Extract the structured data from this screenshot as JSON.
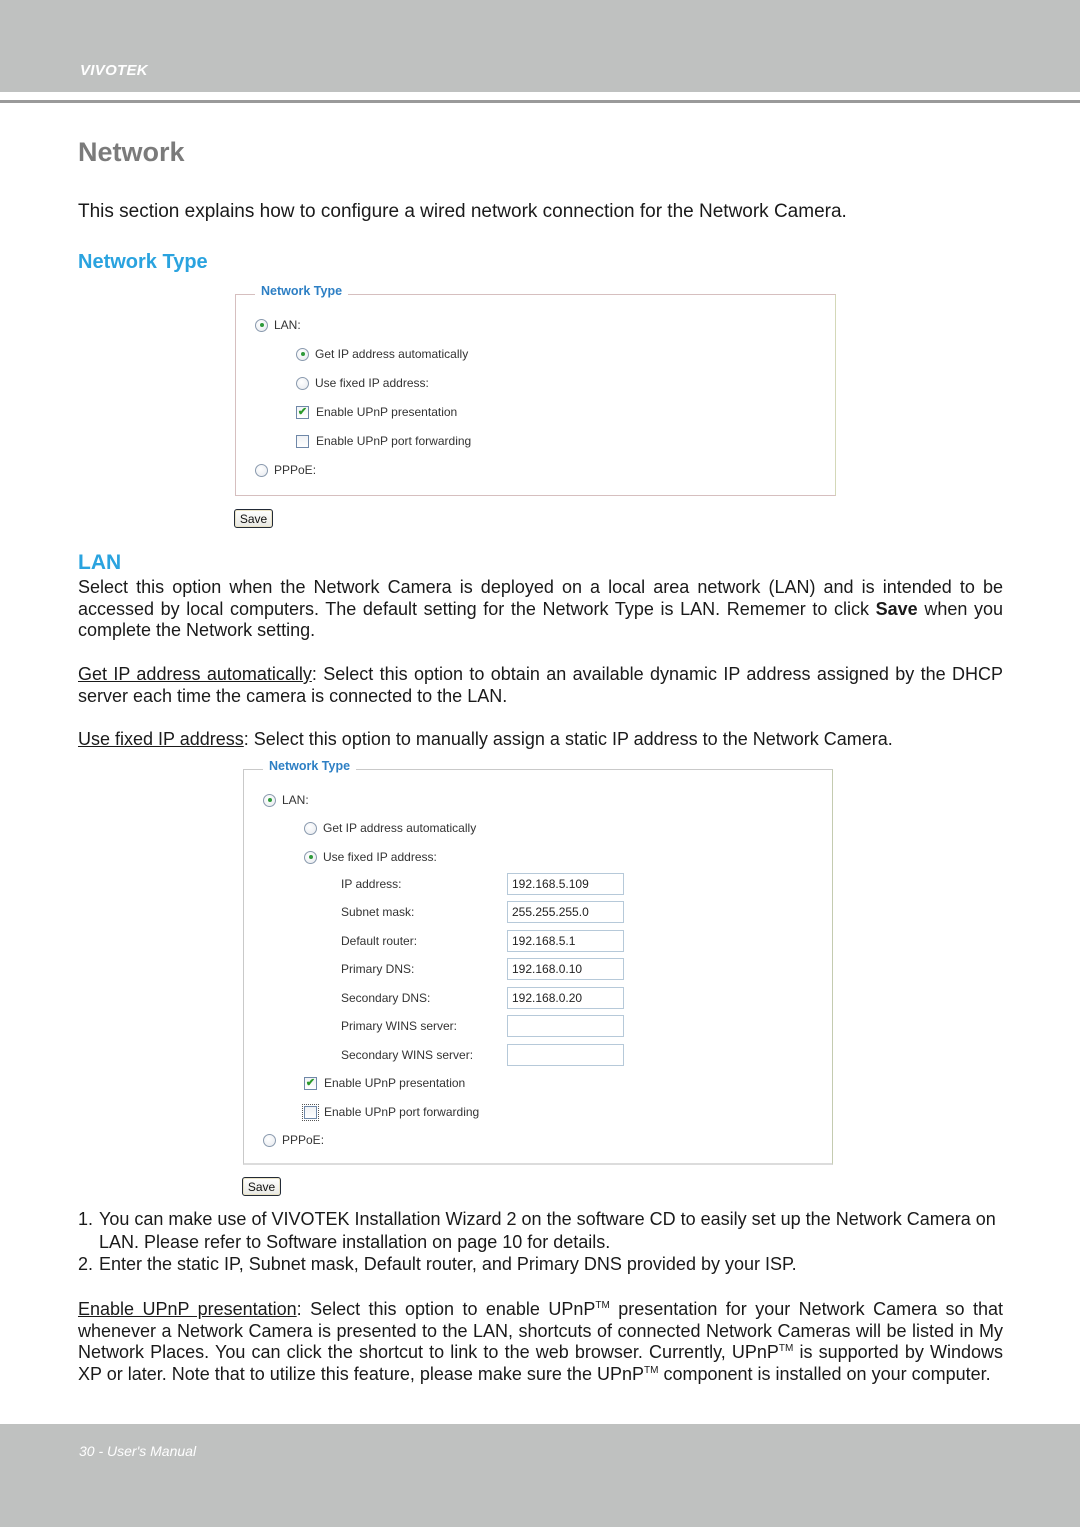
{
  "header": {
    "brand": "VIVOTEK"
  },
  "page": {
    "title": "Network",
    "intro": "This section explains how to configure a wired network connection for the Network Camera.",
    "section_heading": "Network Type"
  },
  "panel1": {
    "legend": "Network Type",
    "lan_label": "LAN:",
    "lan_selected": true,
    "get_ip_auto_label": "Get IP address automatically",
    "get_ip_auto_selected": true,
    "use_fixed_label": "Use fixed IP address:",
    "use_fixed_selected": false,
    "upnp_presentation_label": "Enable UPnP presentation",
    "upnp_presentation_checked": true,
    "upnp_port_forwarding_label": "Enable UPnP port forwarding",
    "upnp_port_forwarding_checked": false,
    "pppoe_label": "PPPoE:",
    "pppoe_selected": false,
    "save_label": "Save",
    "check_glyph": "✔"
  },
  "lan": {
    "heading": "LAN",
    "para1_pre": "Select this option when the Network Camera is deployed on a local area network (LAN) and is intended to be accessed by local computers. The default setting for the Network Type is LAN. Rememer to click ",
    "para1_bold": "Save",
    "para1_post": " when you complete the Network setting.",
    "auto_term": "Get IP address automatically",
    "auto_desc": ": Select this option to obtain an available dynamic IP address assigned by the DHCP server each time the camera is connected to the LAN.",
    "fixed_term": "Use fixed IP address",
    "fixed_desc": ": Select this option to manually assign a static IP address to the Network Camera."
  },
  "panel2": {
    "legend": "Network Type",
    "lan_label": "LAN:",
    "lan_selected": true,
    "get_ip_auto_label": "Get IP address automatically",
    "get_ip_auto_selected": false,
    "use_fixed_label": "Use fixed IP address:",
    "use_fixed_selected": true,
    "fields": [
      {
        "label": "IP address:",
        "value": "192.168.5.109"
      },
      {
        "label": "Subnet mask:",
        "value": "255.255.255.0"
      },
      {
        "label": "Default router:",
        "value": "192.168.5.1"
      },
      {
        "label": "Primary DNS:",
        "value": "192.168.0.10"
      },
      {
        "label": "Secondary DNS:",
        "value": "192.168.0.20"
      },
      {
        "label": "Primary WINS server:",
        "value": ""
      },
      {
        "label": "Secondary WINS server:",
        "value": ""
      }
    ],
    "upnp_presentation_label": "Enable UPnP presentation",
    "upnp_presentation_checked": true,
    "upnp_port_forwarding_label": "Enable UPnP port forwarding",
    "upnp_port_forwarding_checked": false,
    "pppoe_label": "PPPoE:",
    "pppoe_selected": false,
    "save_label": "Save",
    "check_glyph": "✔"
  },
  "notes": [
    {
      "num": "1.",
      "text": "You can make use of VIVOTEK Installation Wizard 2 on the software CD to easily set up the Network Camera on LAN. Please refer to Software installation on page 10 for details."
    },
    {
      "num": "2.",
      "text": "Enter the static IP, Subnet mask, Default router, and Primary DNS provided by your ISP."
    }
  ],
  "upnp": {
    "term": "Enable UPnP presentation",
    "t1": ": Select this option to enable UPnP",
    "tm": "TM",
    "t2": " presentation for your Network Camera so that whenever a Network Camera is presented to the LAN, shortcuts of connected Network Cameras will be listed in My Network Places. You can click the shortcut to link to the web browser. Currently, UPnP",
    "t3": " is supported by Windows XP or later. Note that to utilize this feature, please make sure the UPnP",
    "t4": " component is installed on your computer."
  },
  "footer": {
    "text": "30 - User's Manual"
  }
}
